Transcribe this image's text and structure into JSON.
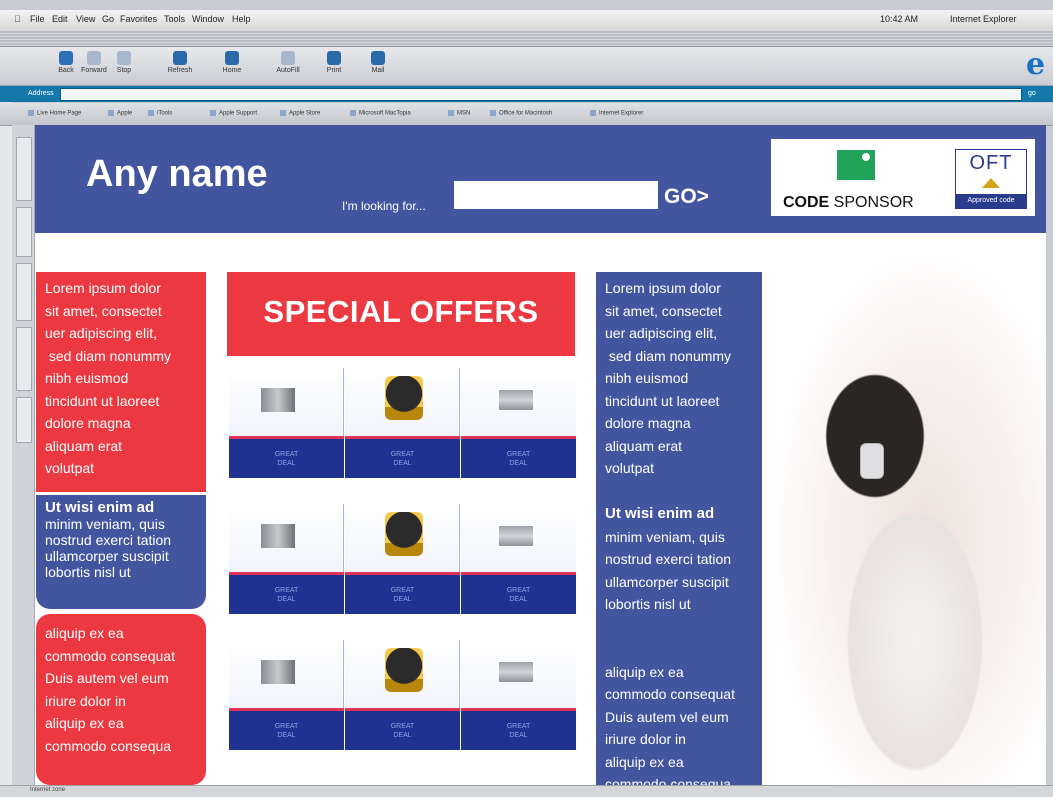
{
  "menubar": {
    "items": [
      "File",
      "Edit",
      "View",
      "Go",
      "Favorites",
      "Tools",
      "Window",
      "Help"
    ],
    "clock": "10:42 AM",
    "app_name": "Internet Explorer"
  },
  "toolbar": {
    "buttons": [
      "Back",
      "Forward",
      "Stop",
      "Refresh",
      "Home",
      "AutoFill",
      "Print",
      "Mail"
    ]
  },
  "address": {
    "label": "Address",
    "value": "",
    "go": "go"
  },
  "favorites": [
    "Live Home Page",
    "Apple",
    "iTools",
    "Apple Support",
    "Apple Store",
    "Microsoft MacTopia",
    "MSN",
    "Office for Macintosh",
    "Internet Explorer"
  ],
  "header": {
    "title": "Any name",
    "looking_label": "I'm looking for...",
    "search_value": "",
    "go_label": "GO>"
  },
  "sponsor": {
    "code": "CODE",
    "sponsor": " SPONSOR",
    "oft": "OFT",
    "approved": "Approved code"
  },
  "left_panels": {
    "p1": "Lorem ipsum dolor\nsit amet, consectet\nuer adipiscing elit,\n sed diam nonummy\nnibh euismod\ntincidunt ut laoreet\ndolore magna\naliquam erat\nvolutpat",
    "p2_lead": "Ut wisi enim ad",
    "p2": "minim veniam, quis\nnostrud exerci tation\nullamcorper suscipit\nlobortis nisl ut",
    "p3": "aliquip ex ea\ncommodo consequat\nDuis autem vel eum\niriure dolor in\naliquip ex ea\ncommodo consequa"
  },
  "right_panel": {
    "p1": "Lorem ipsum dolor\nsit amet, consectet\nuer adipiscing elit,\n sed diam nonummy\nnibh euismod\ntincidunt ut laoreet\ndolore magna\naliquam erat\nvolutpat",
    "p2_lead": "Ut wisi enim ad",
    "p2": "minim veniam, quis\nnostrud exerci tation\nullamcorper suscipit\nlobortis nisl ut",
    "p3": "aliquip ex ea\ncommodo consequat\nDuis autem vel eum\niriure dolor in\naliquip ex ea\ncommodo consequa"
  },
  "offers": {
    "title": "SPECIAL OFFERS",
    "deal_label": "GREAT\nDEAL"
  },
  "status": {
    "text": "Internet zone"
  },
  "colors": {
    "brand_blue": "#4455a0",
    "brand_red": "#ec3840",
    "deal_blue": "#1f3191"
  }
}
